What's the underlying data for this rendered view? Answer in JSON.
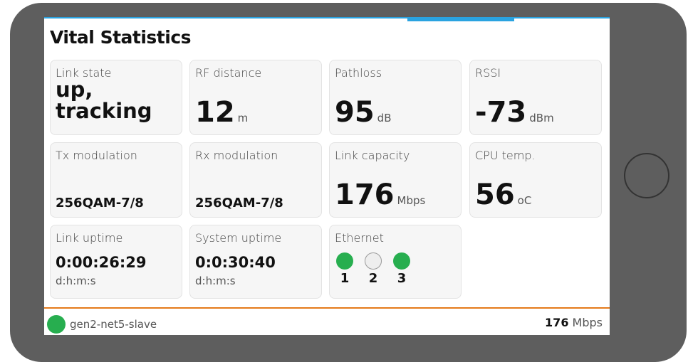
{
  "page": {
    "title": "Vital Statistics"
  },
  "colors": {
    "accent_blue": "#2aa3e0",
    "accent_orange": "#e57a1a",
    "status_green": "#27ae4f",
    "port_idle": "#eeeeee"
  },
  "tiles": {
    "link_state": {
      "label": "Link state",
      "value_line1": "up,",
      "value_line2": "tracking"
    },
    "rf_distance": {
      "label": "RF distance",
      "value": "12",
      "unit": "m"
    },
    "pathloss": {
      "label": "Pathloss",
      "value": "95",
      "unit": "dB"
    },
    "rssi": {
      "label": "RSSI",
      "value": "-73",
      "unit": "dBm"
    },
    "tx_modulation": {
      "label": "Tx modulation",
      "value": "256QAM-7/8"
    },
    "rx_modulation": {
      "label": "Rx modulation",
      "value": "256QAM-7/8"
    },
    "link_capacity": {
      "label": "Link capacity",
      "value": "176",
      "unit": "Mbps"
    },
    "cpu_temp": {
      "label": "CPU temp.",
      "value": "56",
      "unit": "oC"
    },
    "link_uptime": {
      "label": "Link uptime",
      "value": "0:00:26:29",
      "unit": "d:h:m:s"
    },
    "system_uptime": {
      "label": "System uptime",
      "value": "0:0:30:40",
      "unit": "d:h:m:s"
    },
    "ethernet": {
      "label": "Ethernet",
      "ports": [
        {
          "number": "1",
          "status": "up"
        },
        {
          "number": "2",
          "status": "down"
        },
        {
          "number": "3",
          "status": "up"
        }
      ]
    }
  },
  "footer": {
    "node_name": "gen2-net5-slave",
    "throughput_value": "176",
    "throughput_unit": "Mbps",
    "status": "up"
  }
}
